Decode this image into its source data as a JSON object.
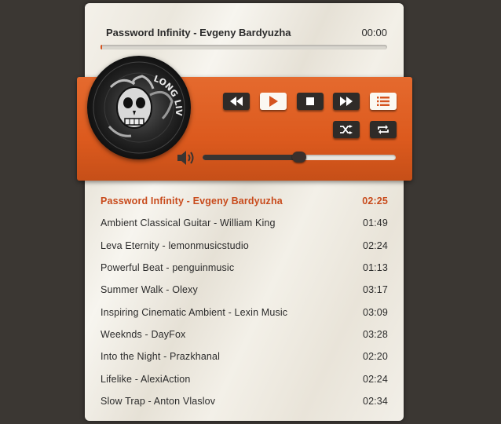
{
  "now_playing": {
    "title": "Password Infinity - Evgeny Bardyuzha",
    "elapsed": "00:00",
    "progress": 0.005
  },
  "controls": {
    "rewind_icon": "rewind-icon",
    "play_icon": "play-icon",
    "stop_icon": "stop-icon",
    "forward_icon": "fast-forward-icon",
    "playlist_icon": "playlist-icon",
    "shuffle_icon": "shuffle-icon",
    "repeat_icon": "repeat-icon",
    "volume_icon": "volume-icon",
    "volume_level": 0.5
  },
  "album_art": {
    "text": "LONG LIVE"
  },
  "colors": {
    "accent": "#d5531f",
    "active_track": "#c84a1b",
    "button_dark": "#2f2b28",
    "background": "#3b3733"
  },
  "playlist": [
    {
      "title": "Password Infinity - Evgeny Bardyuzha",
      "duration": "02:25",
      "current": true
    },
    {
      "title": "Ambient Classical Guitar - William King",
      "duration": "01:49"
    },
    {
      "title": "Leva Eternity - lemonmusicstudio",
      "duration": "02:24"
    },
    {
      "title": "Powerful Beat - penguinmusic",
      "duration": "01:13"
    },
    {
      "title": "Summer Walk - Olexy",
      "duration": "03:17"
    },
    {
      "title": "Inspiring Cinematic Ambient - Lexin Music",
      "duration": "03:09"
    },
    {
      "title": "Weeknds - DayFox",
      "duration": "03:28"
    },
    {
      "title": "Into the Night - Prazkhanal",
      "duration": "02:20"
    },
    {
      "title": "Lifelike - AlexiAction",
      "duration": "02:24"
    },
    {
      "title": "Slow Trap - Anton Vlaslov",
      "duration": "02:34"
    }
  ]
}
